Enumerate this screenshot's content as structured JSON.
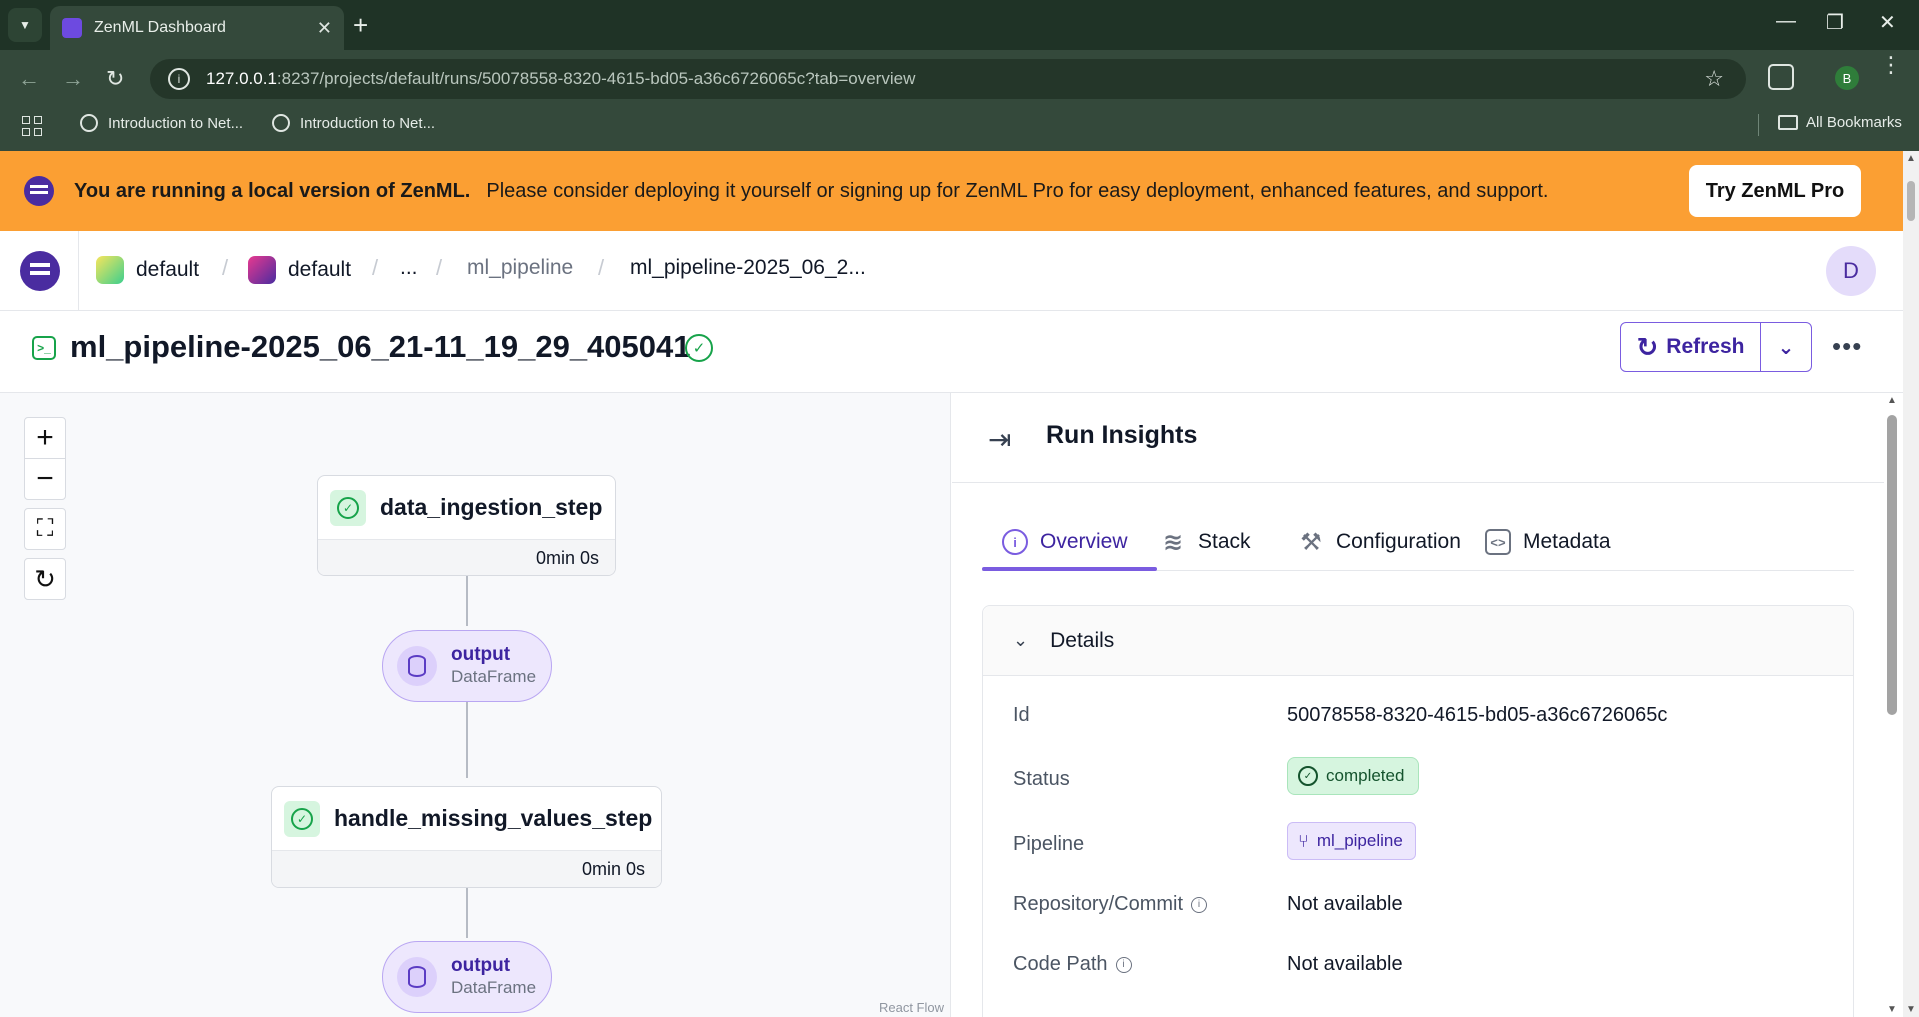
{
  "browser": {
    "tab_title": "ZenML Dashboard",
    "url_host": "127.0.0.1",
    "url_path": ":8237/projects/default/runs/50078558-8320-4615-bd05-a36c6726065c?tab=overview",
    "bookmarks": [
      "Introduction to Net...",
      "Introduction to Net..."
    ],
    "all_bookmarks": "All Bookmarks",
    "profile_initial": "B"
  },
  "banner": {
    "headline": "You are running a local version of ZenML.",
    "message": "Please consider deploying it yourself or signing up for ZenML Pro for easy deployment, enhanced features, and support.",
    "cta": "Try ZenML Pro",
    "color": "#fb9f33"
  },
  "header": {
    "breadcrumbs": [
      "default",
      "default",
      "...",
      "ml_pipeline",
      "ml_pipeline-2025_06_2..."
    ],
    "avatar_initial": "D"
  },
  "run": {
    "title": "ml_pipeline-2025_06_21-11_19_29_405041",
    "refresh_label": "Refresh"
  },
  "canvas": {
    "steps": [
      {
        "name": "data_ingestion_step",
        "duration": "0min 0s"
      },
      {
        "name": "handle_missing_values_step",
        "duration": "0min 0s"
      }
    ],
    "artifacts": [
      {
        "name": "output",
        "type": "DataFrame"
      },
      {
        "name": "output",
        "type": "DataFrame"
      }
    ],
    "attribution": "React Flow"
  },
  "panel": {
    "title": "Run Insights",
    "tabs": [
      "Overview",
      "Stack",
      "Configuration",
      "Metadata"
    ],
    "active_tab": "Overview",
    "details_title": "Details",
    "labels": {
      "id": "Id",
      "status": "Status",
      "pipeline": "Pipeline",
      "repo": "Repository/Commit",
      "code_path": "Code Path"
    },
    "values": {
      "id": "50078558-8320-4615-bd05-a36c6726065c",
      "status": "completed",
      "pipeline": "ml_pipeline",
      "repo": "Not available",
      "code_path": "Not available"
    }
  },
  "colors": {
    "accent": "#7a5ce0",
    "success": "#17a34a"
  }
}
